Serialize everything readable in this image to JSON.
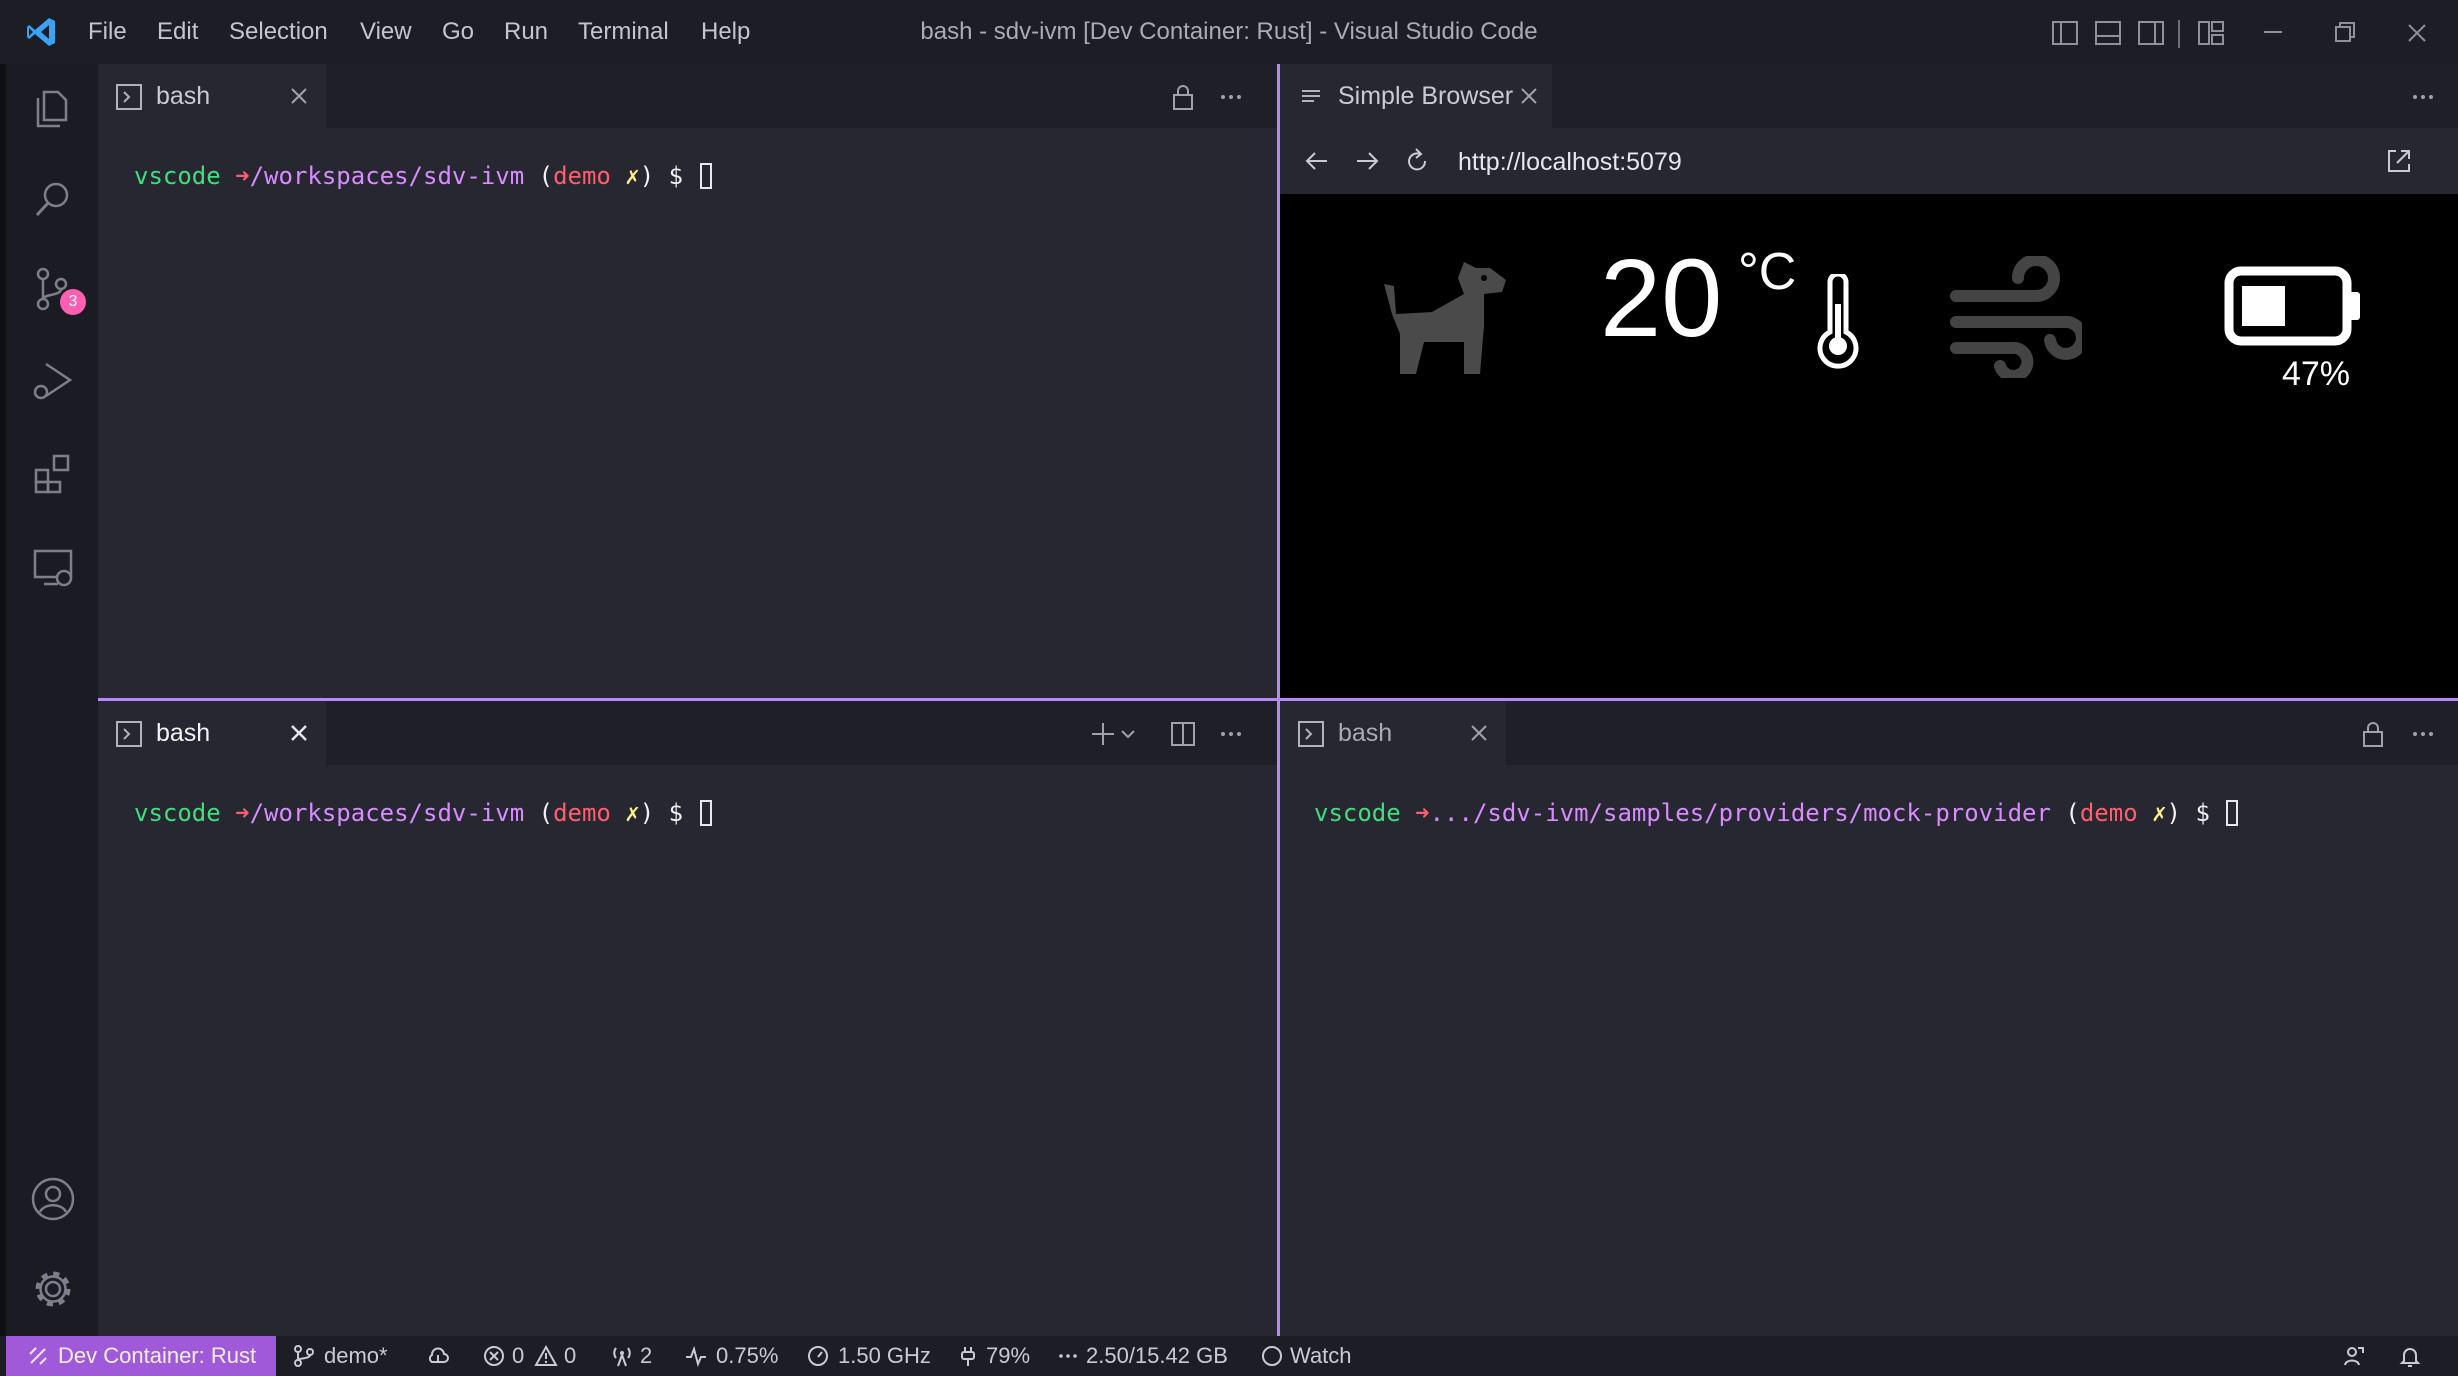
{
  "window": {
    "title": "bash - sdv-ivm [Dev Container: Rust] - Visual Studio Code"
  },
  "menu": [
    "File",
    "Edit",
    "Selection",
    "View",
    "Go",
    "Run",
    "Terminal",
    "Help"
  ],
  "activity_bar": {
    "scm_badge": "3"
  },
  "terminal_top_left": {
    "tab_label": "bash",
    "prompt": {
      "user": "vscode",
      "arrow": "➜",
      "path": "/workspaces/sdv-ivm",
      "open_paren": " (",
      "branch": "demo",
      "dirty": " ✗",
      "close_paren": ")",
      "dollar": " $ "
    }
  },
  "browser": {
    "tab_label": "Simple Browser",
    "url": "http://localhost:5079",
    "temperature": "20",
    "temperature_unit": "°C",
    "battery_percent": "47%",
    "battery_level": 0.47
  },
  "terminal_bottom_left": {
    "tab_label": "bash",
    "prompt": {
      "user": "vscode",
      "arrow": "➜",
      "path": "/workspaces/sdv-ivm",
      "open_paren": " (",
      "branch": "demo",
      "dirty": " ✗",
      "close_paren": ")",
      "dollar": " $ "
    }
  },
  "terminal_bottom_right": {
    "tab_label": "bash",
    "prompt": {
      "user": "vscode",
      "arrow": "➜",
      "path": ".../sdv-ivm/samples/providers/mock-provider",
      "open_paren": " (",
      "branch": "demo",
      "dirty": " ✗",
      "close_paren": ")",
      "dollar": " $ "
    }
  },
  "status_bar": {
    "remote": "Dev Container: Rust",
    "branch": "demo*",
    "errors": "0",
    "warnings": "0",
    "ports": "2",
    "cpu": "0.75%",
    "frequency": "1.50 GHz",
    "battery": "79%",
    "memory": "2.50/15.42 GB",
    "watch": "Watch"
  },
  "colors": {
    "accent": "#b787ff",
    "remote_bg": "#a05ad9",
    "prompt_user": "#3ee07d",
    "prompt_path": "#d88cff",
    "prompt_branch": "#ff5f6d",
    "badge": "#ff5fb0"
  }
}
